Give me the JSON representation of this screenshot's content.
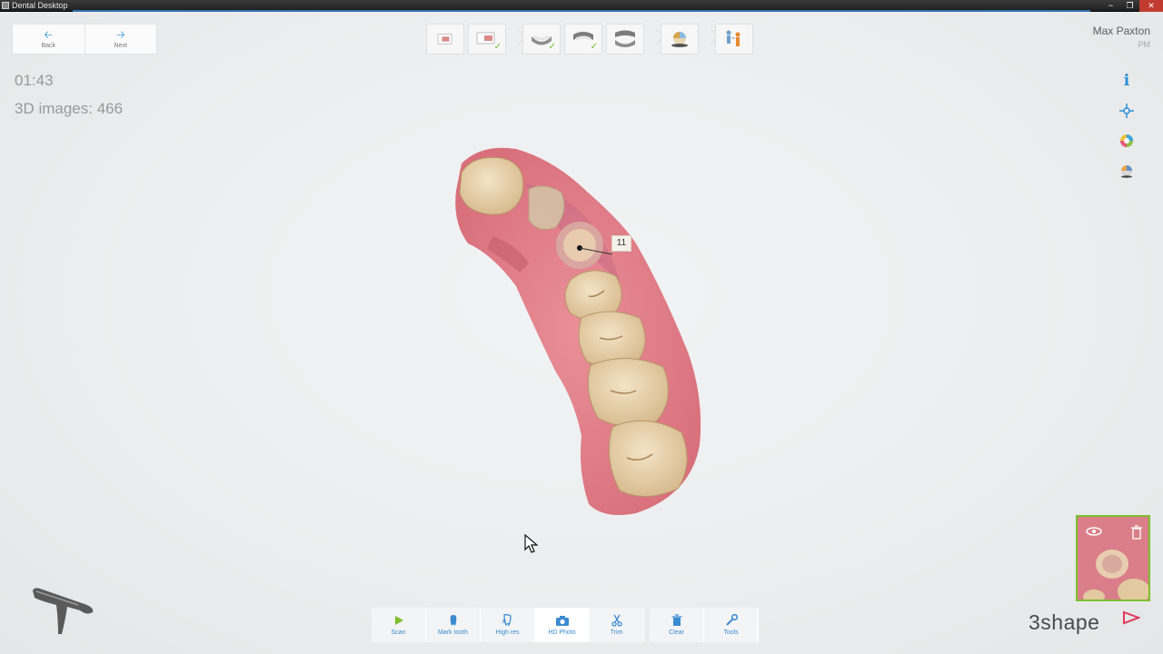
{
  "window": {
    "title": "Dental Desktop"
  },
  "nav": {
    "back_label": "Back",
    "next_label": "Next"
  },
  "user": {
    "name": "Max Paxton",
    "subtitle": "PM"
  },
  "status": {
    "timer": "01:43",
    "images_count": "3D images: 466"
  },
  "tooth_marker": {
    "label": "11"
  },
  "workflow_steps": [
    {
      "icon": "order-form-icon",
      "checked": false
    },
    {
      "icon": "order-check-icon",
      "checked": true
    },
    {
      "icon": "lower-jaw-icon",
      "checked": true
    },
    {
      "icon": "upper-jaw-icon",
      "checked": true
    },
    {
      "icon": "bite-icon",
      "checked": false
    },
    {
      "icon": "color-analysis-icon",
      "checked": false
    },
    {
      "icon": "send-icon",
      "checked": false
    }
  ],
  "right_tools": [
    {
      "icon": "info-icon"
    },
    {
      "icon": "center-view-icon"
    },
    {
      "icon": "color-texture-icon"
    },
    {
      "icon": "shade-sphere-icon"
    }
  ],
  "bottom_toolbar": [
    {
      "label": "Scan",
      "icon": "play-icon"
    },
    {
      "label": "Mark tooth",
      "icon": "mark-tooth-icon"
    },
    {
      "label": "High res",
      "icon": "high-res-icon"
    },
    {
      "label": "HD Photo",
      "icon": "camera-icon",
      "active": true
    },
    {
      "label": "Trim",
      "icon": "scissors-icon"
    },
    {
      "label": "Clear",
      "icon": "trash-icon"
    },
    {
      "label": "Tools",
      "icon": "wrench-icon"
    }
  ],
  "brand": {
    "logo_text": "3shape"
  },
  "colors": {
    "accent": "#2a8fd6",
    "gum": "#de7e88",
    "tooth": "#e9d5b0",
    "check": "#6fbf2e"
  }
}
